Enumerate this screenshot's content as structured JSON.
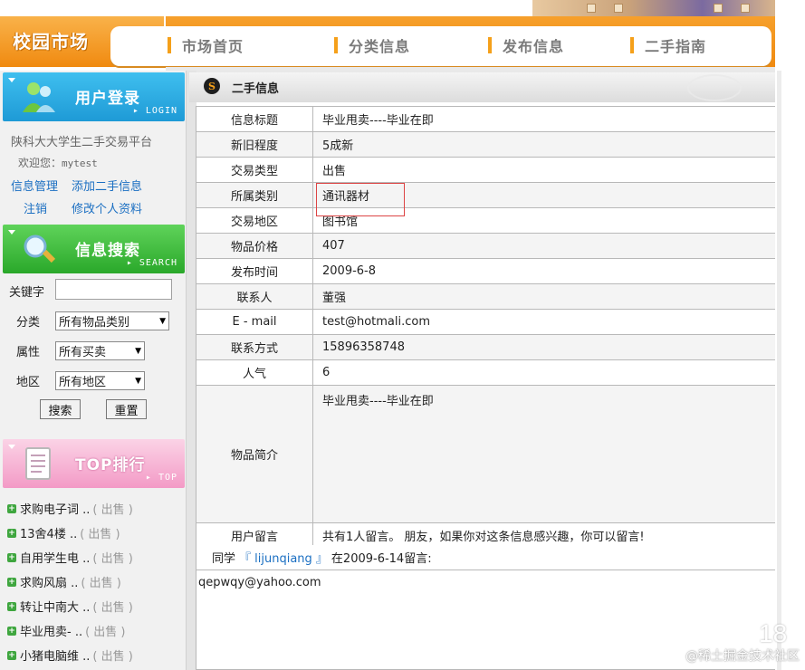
{
  "header": {
    "logo": "校园市场",
    "nav": [
      "市场首页",
      "分类信息",
      "发布信息",
      "二手指南"
    ]
  },
  "sidebar": {
    "login_panel": {
      "title": "用户登录",
      "subtitle": "LOGIN"
    },
    "site_name": "陕科大大学生二手交易平台",
    "welcome_prefix": "欢迎您：",
    "username": "mytest",
    "links": [
      "信息管理",
      "添加二手信息",
      "注销",
      "修改个人资料"
    ],
    "search_panel": {
      "title": "信息搜索",
      "subtitle": "SEARCH"
    },
    "search": {
      "keyword_label": "关键字",
      "keyword_value": "",
      "category_label": "分类",
      "category_value": "所有物品类别",
      "attr_label": "属性",
      "attr_value": "所有买卖",
      "region_label": "地区",
      "region_value": "所有地区",
      "search_button": "搜索",
      "reset_button": "重置"
    },
    "top_panel": {
      "title": "TOP排行",
      "subtitle": "TOP"
    },
    "top_list": [
      {
        "title": "求购电子词 ..",
        "tag": "( 出售 )"
      },
      {
        "title": "13舍4楼 ..",
        "tag": "( 出售 )"
      },
      {
        "title": "自用学生电 ..",
        "tag": "( 出售 )"
      },
      {
        "title": "求购风扇 ..",
        "tag": "( 出售 )"
      },
      {
        "title": "转让中南大 ..",
        "tag": "( 出售 )"
      },
      {
        "title": "毕业甩卖- ..",
        "tag": "( 出售 )"
      },
      {
        "title": "小猪电脑维 ..",
        "tag": "( 出售 )"
      }
    ]
  },
  "main": {
    "section_title": "二手信息",
    "fields": [
      {
        "key": "信息标题",
        "value": "毕业甩卖----毕业在即"
      },
      {
        "key": "新旧程度",
        "value": "5成新"
      },
      {
        "key": "交易类型",
        "value": "出售"
      },
      {
        "key": "所属类别",
        "value": "通讯器材"
      },
      {
        "key": "交易地区",
        "value": "图书馆"
      },
      {
        "key": "物品价格",
        "value": "407"
      },
      {
        "key": "发布时间",
        "value": "2009-6-8"
      },
      {
        "key": "联系人",
        "value": "董强"
      },
      {
        "key": "E - mail",
        "value": "test@hotmali.com"
      },
      {
        "key": "联系方式",
        "value": "15896358748"
      },
      {
        "key": "人气",
        "value": "6"
      }
    ],
    "description": {
      "key": "物品简介",
      "value": "毕业甩卖----毕业在即"
    },
    "comments": {
      "key": "用户留言",
      "value": "共有1人留言。 朋友，如果你对这条信息感兴趣，你可以留言!"
    },
    "comment_entry": {
      "prefix": "同学",
      "user": "『 lijunqiang 』",
      "suffix": "在2009-6-14留言:",
      "content": "qepwqy@yahoo.com"
    }
  },
  "watermark": "@稀土掘金技术社区",
  "corner_number": "18"
}
